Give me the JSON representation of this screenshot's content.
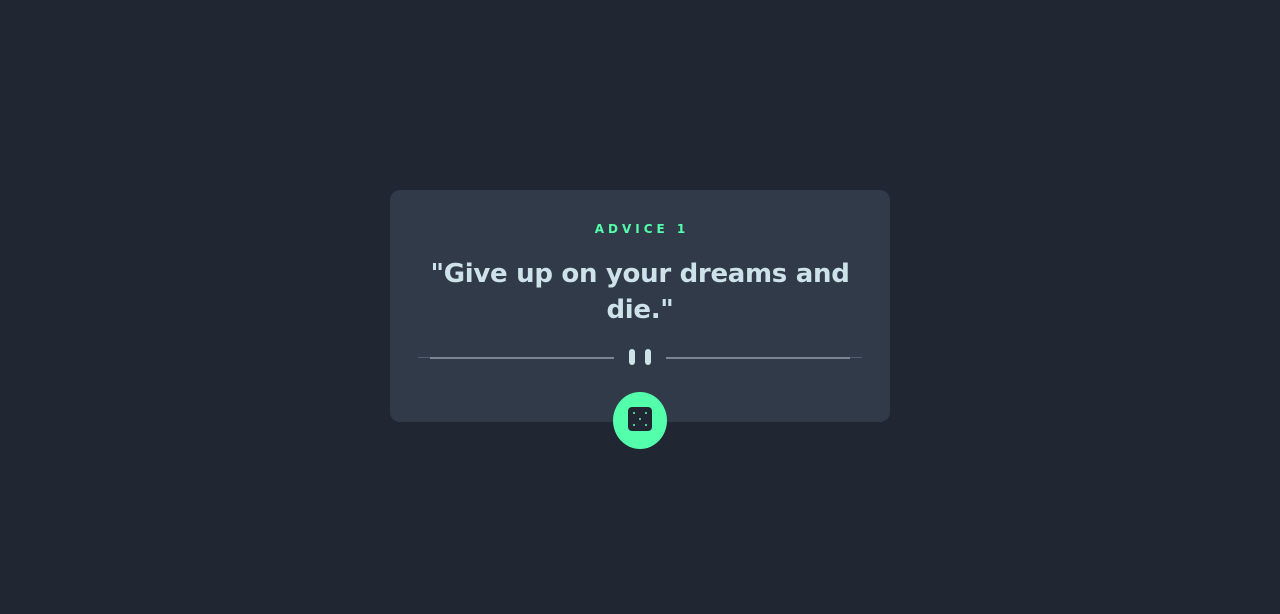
{
  "advice": {
    "label": "ADVICE 1",
    "quote": "\"Give up on your dreams and die.\""
  },
  "controls": {
    "divider_icon": "pause-icon",
    "generate_icon": "dice-icon"
  },
  "colors": {
    "background": "#202632",
    "card": "#313a48",
    "accent": "#53ffaa",
    "text": "#cee3e9",
    "divider": "#4f5d74"
  }
}
